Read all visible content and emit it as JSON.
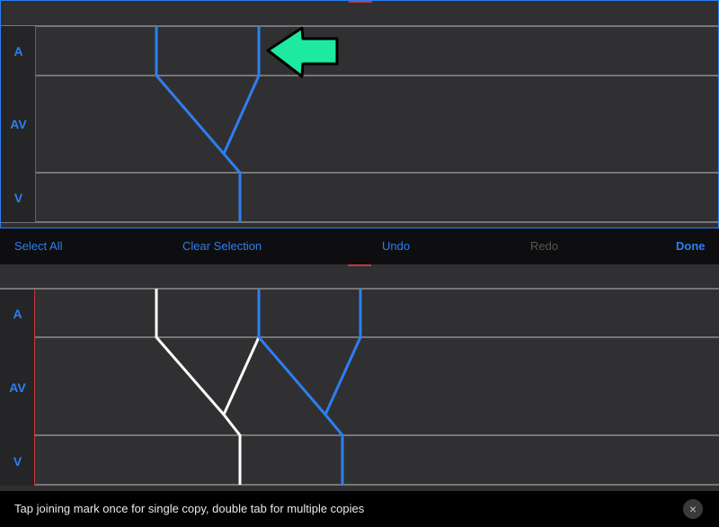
{
  "lanes": [
    "A",
    "AV",
    "V"
  ],
  "toolbar": {
    "select_all": "Select All",
    "clear_selection": "Clear Selection",
    "undo": "Undo",
    "redo": "Redo",
    "done": "Done"
  },
  "footer": {
    "message": "Tap joining mark once for single copy, double tab for multiple copies",
    "close_icon": "×"
  },
  "colors": {
    "accent": "#2d7ff0",
    "selected_mark": "#ffffff",
    "arrow": "#1de9a0",
    "lane_border": "#c0393b"
  },
  "icons": [
    "arrow-left-icon",
    "close-icon"
  ]
}
